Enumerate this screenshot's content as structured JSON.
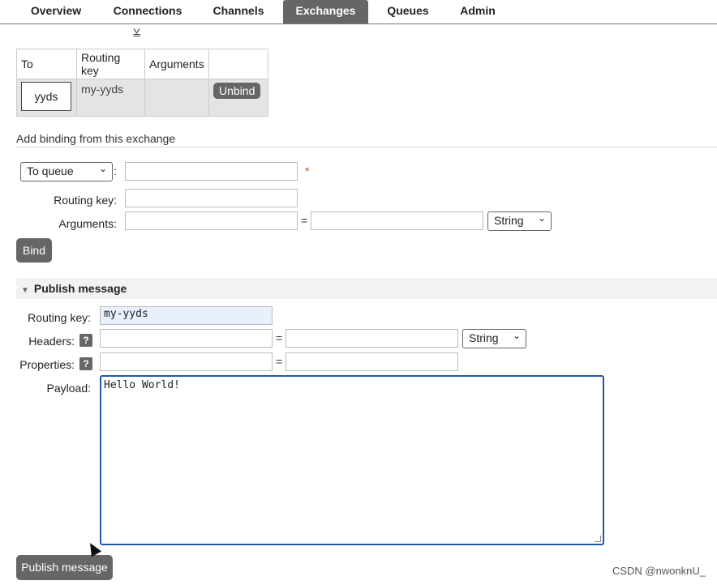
{
  "nav": {
    "tabs": [
      "Overview",
      "Connections",
      "Channels",
      "Exchanges",
      "Queues",
      "Admin"
    ],
    "active": "Exchanges"
  },
  "bindings": {
    "headers": [
      "To",
      "Routing key",
      "Arguments",
      ""
    ],
    "rows": [
      {
        "to": "yyds",
        "routing_key": "my-yyds",
        "arguments": "",
        "action": "Unbind"
      }
    ]
  },
  "add_binding": {
    "title": "Add binding from this exchange",
    "destination_type": "To queue",
    "destination_value": "",
    "required_marker": "*",
    "routing_key_label": "Routing key:",
    "routing_key_value": "",
    "arguments_label": "Arguments:",
    "arguments_key": "",
    "arguments_value": "",
    "arguments_type": "String",
    "equals": "=",
    "colon": ":",
    "bind_button": "Bind"
  },
  "publish": {
    "title": "Publish message",
    "routing_key_label": "Routing key:",
    "routing_key_value": "my-yyds",
    "headers_label": "Headers:",
    "headers_type": "String",
    "properties_label": "Properties:",
    "help": "?",
    "equals": "=",
    "payload_label": "Payload:",
    "payload_value": "Hello World!",
    "publish_button": "Publish message"
  },
  "watermark": "CSDN @nwonknU_"
}
